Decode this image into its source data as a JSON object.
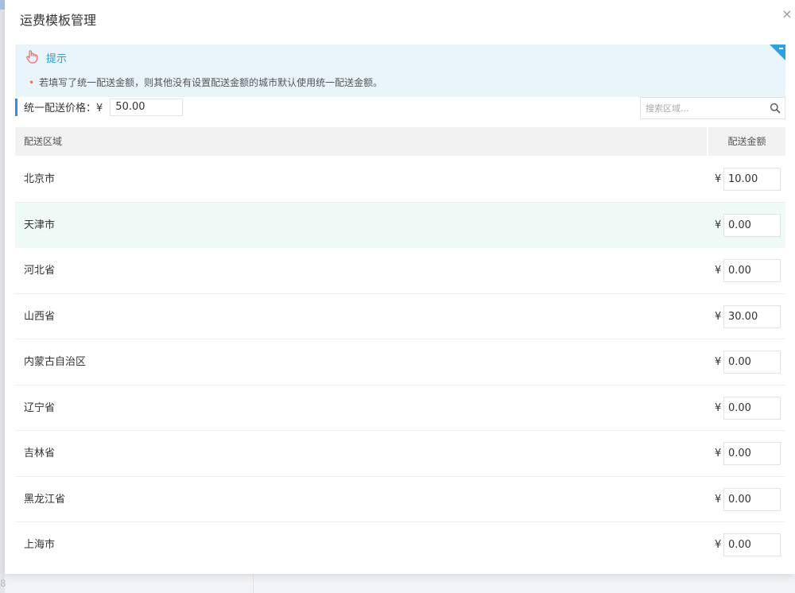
{
  "modal": {
    "title": "运费模板管理",
    "close": "×"
  },
  "tip": {
    "title": "提示",
    "text": "若填写了统一配送金额，则其他没有设置配送金额的城市默认使用统一配送金额。",
    "bullet": "•"
  },
  "uniform": {
    "label": "统一配送价格：",
    "currency": "¥",
    "value": "50.00"
  },
  "search": {
    "placeholder": "搜索区域..."
  },
  "table": {
    "headers": {
      "region": "配送区域",
      "amount": "配送金额"
    },
    "currency": "¥",
    "rows": [
      {
        "name": "北京市",
        "amount": "10.00"
      },
      {
        "name": "天津市",
        "amount": "0.00"
      },
      {
        "name": "河北省",
        "amount": "0.00"
      },
      {
        "name": "山西省",
        "amount": "30.00"
      },
      {
        "name": "内蒙古自治区",
        "amount": "0.00"
      },
      {
        "name": "辽宁省",
        "amount": "0.00"
      },
      {
        "name": "吉林省",
        "amount": "0.00"
      },
      {
        "name": "黑龙江省",
        "amount": "0.00"
      },
      {
        "name": "上海市",
        "amount": "0.00"
      }
    ]
  },
  "background": {
    "page_number": "8"
  },
  "colors": {
    "accent": "#2d8cf0",
    "tip_bg": "#e9f5fb",
    "tip_title": "#1e9fda",
    "row_hover": "#f0faf7"
  }
}
